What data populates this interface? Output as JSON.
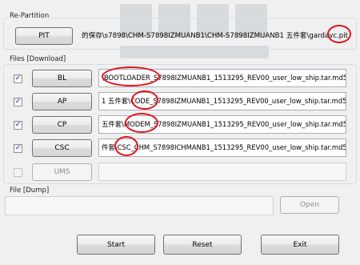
{
  "repartition": {
    "title": "Re-Partition",
    "pit_button": "PIT",
    "pit_path": "的保存\\s7898\\CHM-S7898IZMUANB1\\CHM-S7898IZMUANB1 五件套\\gardav",
    "pit_path_highlight": "c.pit"
  },
  "files_download": {
    "title": "Files [Download]",
    "rows": [
      {
        "label": "BL",
        "checked": true,
        "path_prefix": "\\",
        "highlight": "BOOTLOADER",
        "path_suffix": "_S7898IZMUANB1_1513295_REV00_user_low_ship.tar.md5"
      },
      {
        "label": "AP",
        "checked": true,
        "path_prefix": "1 五件套\\",
        "highlight": "CODE",
        "path_suffix": "_S7898IZMUANB1_1513295_REV00_user_low_ship.tar.md5"
      },
      {
        "label": "CP",
        "checked": true,
        "path_prefix": "五件套\\",
        "highlight": "MODEM",
        "path_suffix": "_S7898IZMUANB1_1513295_REV00_user_low_ship.tar.md5"
      },
      {
        "label": "CSC",
        "checked": true,
        "path_prefix": "件套\\",
        "highlight": "CSC",
        "path_suffix": "_CHM_S7898ICHMANB1_1513295_REV00_user_low_ship.tar.md5"
      }
    ],
    "ums": {
      "label": "UMS",
      "checked": false,
      "path": ""
    }
  },
  "file_dump": {
    "title": "File [Dump]",
    "path": "",
    "open_button": "Open"
  },
  "actions": {
    "start": "Start",
    "reset": "Reset",
    "exit": "Exit"
  },
  "colors": {
    "highlight_oval": "#e0141e",
    "check_mark": "#1f3f8f"
  }
}
